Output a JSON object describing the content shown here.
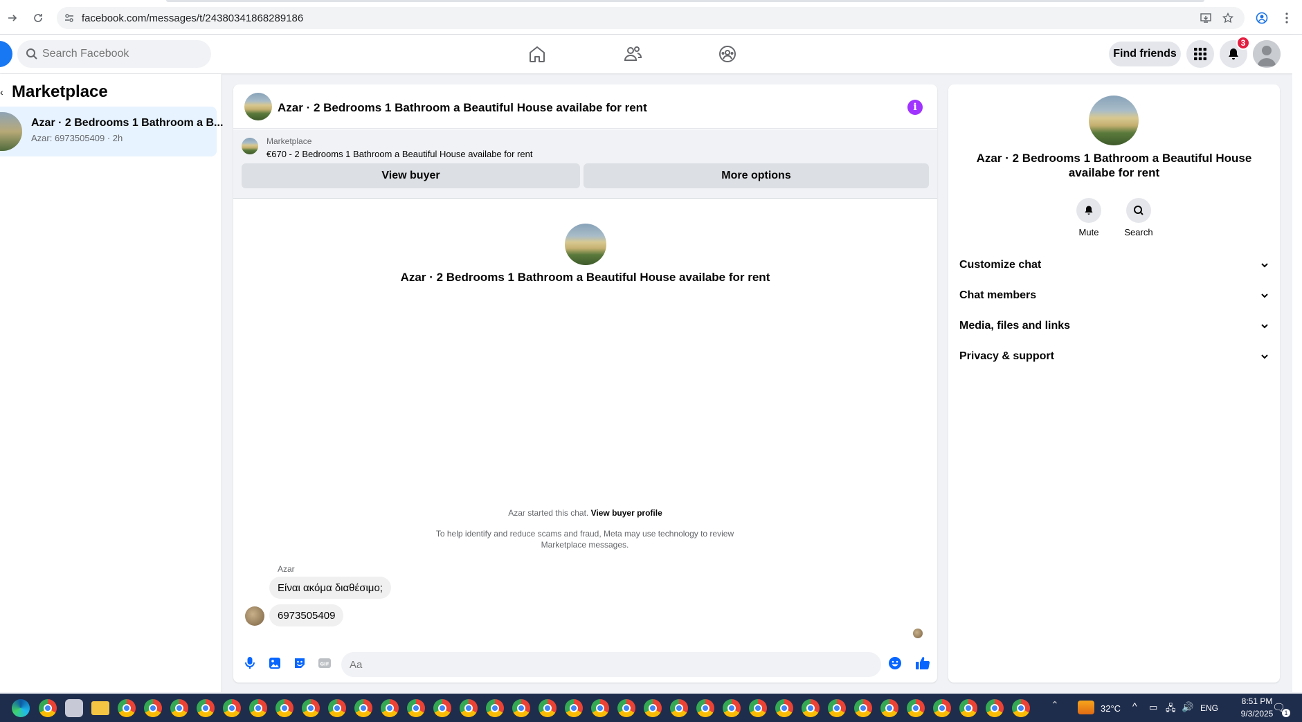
{
  "browser": {
    "url": "facebook.com/messages/t/24380341868289186"
  },
  "header": {
    "search_placeholder": "Search Facebook",
    "find_friends_label": "Find friends",
    "notification_count": "3"
  },
  "left_panel": {
    "title": "Marketplace",
    "conversations": [
      {
        "name": "Azar · 2 Bedrooms 1 Bathroom a B...",
        "subtitle": "Azar: 6973505409 · 2h"
      }
    ]
  },
  "chat": {
    "title": "Azar · 2 Bedrooms 1 Bathroom a Beautiful House availabe for rent",
    "listing": {
      "label": "Marketplace",
      "price_title": "€670 - 2 Bedrooms 1 Bathroom a Beautiful House availabe for rent",
      "view_buyer_label": "View buyer",
      "more_options_label": "More options"
    },
    "center_name": "Azar · 2 Bedrooms 1 Bathroom a Beautiful House availabe for rent",
    "started_text": "Azar started this chat.",
    "started_link": "View buyer profile",
    "scam_note": "To help identify and reduce scams and fraud, Meta may use technology to review Marketplace messages.",
    "sender": "Azar",
    "messages": [
      "Είναι ακόμα διαθέσιμο;",
      "6973505409"
    ],
    "composer_placeholder": "Aa"
  },
  "right_panel": {
    "name": "Azar · 2 Bedrooms 1 Bathroom a Beautiful House availabe for rent",
    "actions": [
      {
        "label": "Mute",
        "icon": "bell-icon"
      },
      {
        "label": "Search",
        "icon": "search-icon"
      }
    ],
    "sections": [
      "Customize chat",
      "Chat members",
      "Media, files and links",
      "Privacy & support"
    ]
  },
  "taskbar": {
    "temperature": "32°C",
    "language": "ENG",
    "time": "8:51 PM",
    "date": "9/3/2025",
    "notification_count": "1"
  },
  "colors": {
    "fb_blue": "#1877f2",
    "info_purple": "#a033ff",
    "selected_bg": "#e7f3ff",
    "badge_red": "#e41e3f"
  }
}
